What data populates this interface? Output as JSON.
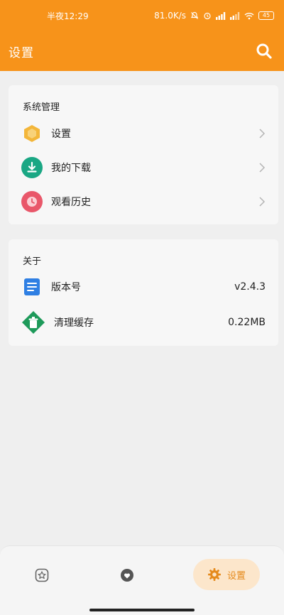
{
  "status_bar": {
    "time": "半夜12:29",
    "network_speed": "81.0K/s",
    "battery": "45"
  },
  "app_bar": {
    "title": "设置",
    "search_icon": "search-icon"
  },
  "sections": {
    "system": {
      "title": "系统管理",
      "items": [
        {
          "label": "设置",
          "icon": "hexagon-settings-icon",
          "color": "#f3b63a"
        },
        {
          "label": "我的下载",
          "icon": "download-icon",
          "color": "#1aa784"
        },
        {
          "label": "观看历史",
          "icon": "clock-icon",
          "color": "#e9576a"
        }
      ]
    },
    "about": {
      "title": "关于",
      "items": [
        {
          "label": "版本号",
          "value": "v2.4.3",
          "icon": "document-icon",
          "color": "#2f7fe3"
        },
        {
          "label": "清理缓存",
          "value": "0.22MB",
          "icon": "trash-icon",
          "color": "#1e9a5a"
        }
      ]
    }
  },
  "bottom_nav": {
    "items": [
      {
        "icon": "star-icon"
      },
      {
        "icon": "heart-icon"
      },
      {
        "label": "设置",
        "icon": "gear-icon",
        "active": true
      }
    ]
  },
  "colors": {
    "accent": "#f7931a",
    "background": "#efefef"
  }
}
